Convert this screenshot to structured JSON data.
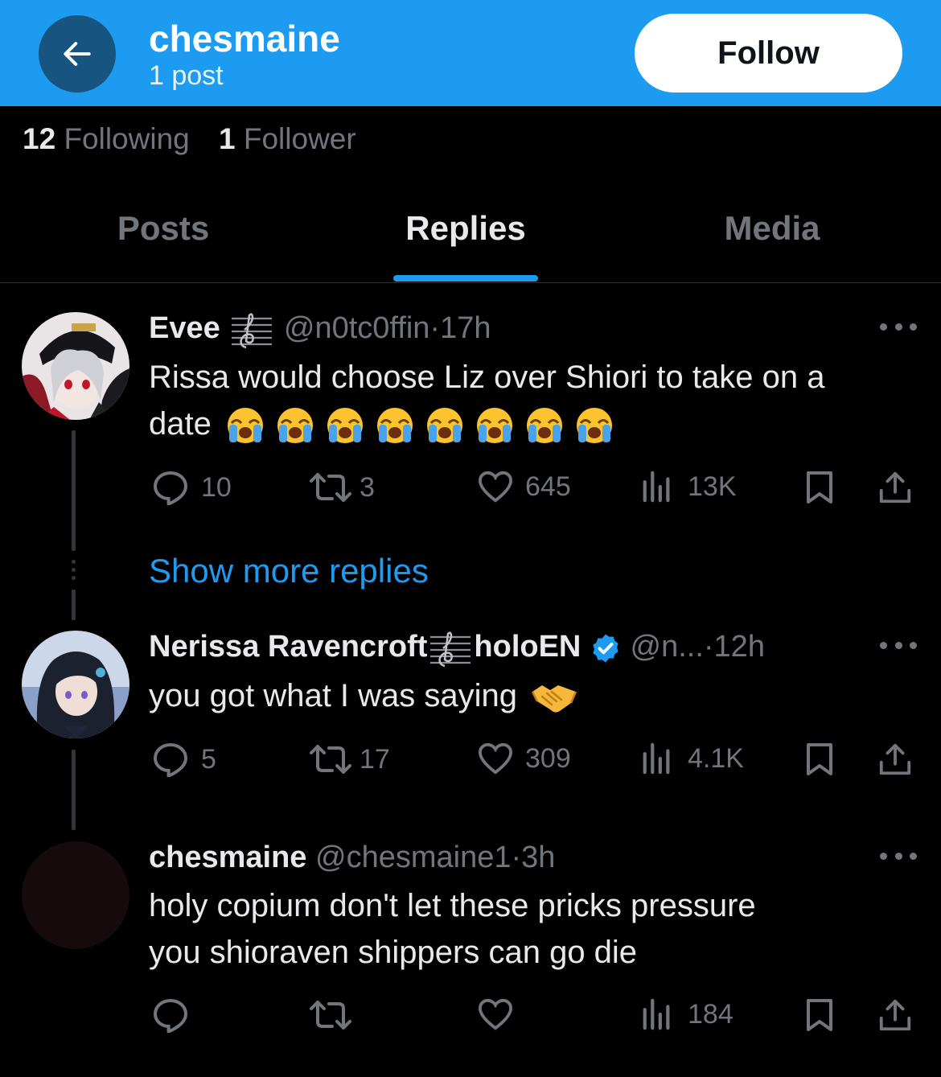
{
  "header": {
    "name": "chesmaine",
    "post_count": "1 post",
    "follow_label": "Follow",
    "back_icon": "arrow-left-icon",
    "background_color": "#1d9bf0"
  },
  "stats": {
    "following_count": "12",
    "following_label": "Following",
    "follower_count": "1",
    "follower_label": "Follower"
  },
  "tabs": [
    {
      "label": "Posts",
      "active": false
    },
    {
      "label": "Replies",
      "active": true
    },
    {
      "label": "Media",
      "active": false
    }
  ],
  "posts": [
    {
      "name": "Evee",
      "name_suffix_icon": "music-staff-icon",
      "handle": "@n0tc0ffin",
      "time": "17h",
      "text_line1": "Rissa would choose Liz over Shiori to take on a",
      "text_line2": "date",
      "emoji": "loudly-crying-face",
      "emoji_count": 8,
      "replies": "10",
      "reposts": "3",
      "likes": "645",
      "views": "13K"
    },
    {
      "name": "Nerissa Ravencroft",
      "name_mid_icon": "music-staff-icon",
      "name_suffix": "holoEN",
      "verified_icon": "verified-badge-icon",
      "handle": "@n...",
      "time": "12h",
      "text_line1": "you got what I was saying",
      "emoji": "handshake",
      "replies": "5",
      "reposts": "17",
      "likes": "309",
      "views": "4.1K"
    },
    {
      "name": "chesmaine",
      "handle": "@chesmaine1",
      "time": "3h",
      "text_line1": "holy copium don't let these pricks pressure",
      "text_line2": "you shioraven shippers can go die",
      "replies": "",
      "reposts": "",
      "likes": "",
      "views": "184"
    }
  ],
  "show_more_replies": "Show more replies",
  "separator": "·",
  "colors": {
    "accent": "#1d9bf0",
    "secondary_text": "#71767b",
    "primary_text": "#e7e9ea",
    "background": "#000000"
  }
}
